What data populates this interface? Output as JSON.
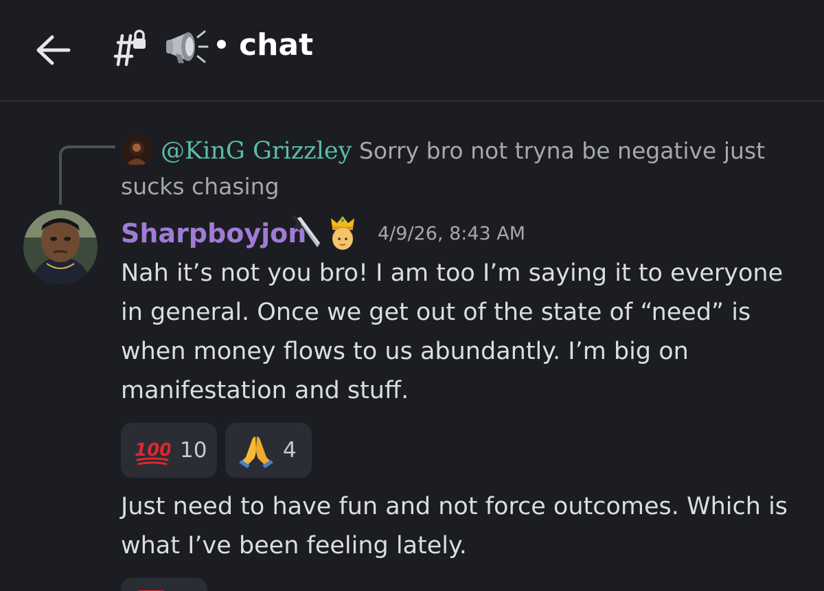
{
  "header": {
    "channel_name": "chat"
  },
  "reply": {
    "author": "@KinG Grizzley",
    "text": "Sorry bro not tryna be negative just sucks chasing"
  },
  "message": {
    "username": "Sharpboyjon",
    "timestamp": "4/9/26, 8:43 AM",
    "text1": "Nah it’s not you bro! I am too I’m saying it to everyone in general. Once we get out of the state of “need” is when money flows to us abundantly. I’m big on manifestation and stuff.",
    "reactions": [
      {
        "emoji": "hundred-points-icon",
        "count": "10"
      },
      {
        "emoji": "folded-hands-icon",
        "count": "4"
      }
    ],
    "text2": "Just need to have fun and not force outcomes. Which is what I’ve been feeling lately."
  },
  "colors": {
    "background": "#1c1d22",
    "username": "#a07bd6",
    "reply_author": "#57c0a6",
    "reaction_bg": "#2b2d34"
  }
}
